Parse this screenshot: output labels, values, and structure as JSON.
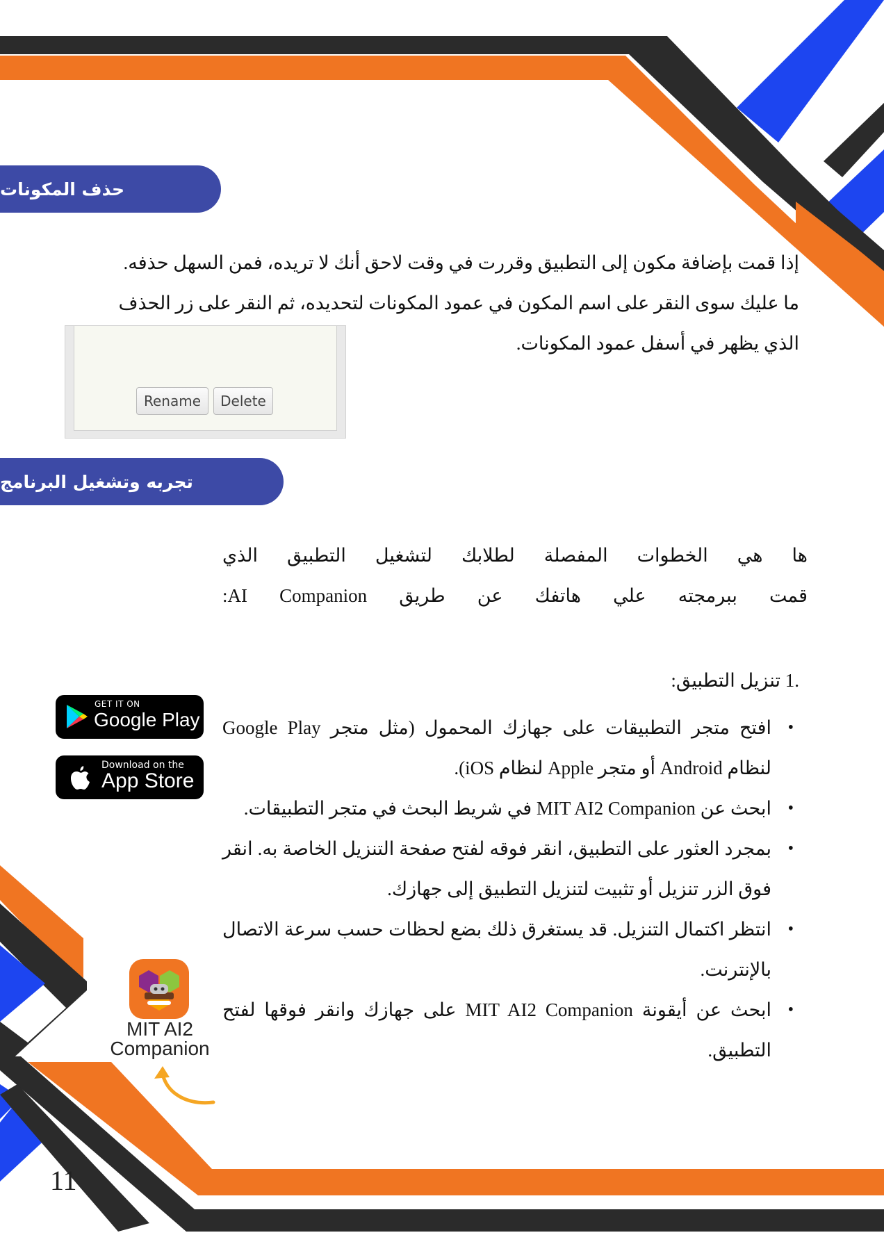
{
  "sections": {
    "delete_title": "حذف المكونات",
    "run_title": "تجربه وتشغيل البرنامج"
  },
  "delete_paragraph": {
    "line1": "إذا قمت بإضافة مكون إلى التطبيق وقررت في وقت لاحق أنك لا تريده، فمن السهل حذفه.",
    "line2": "ما عليك سوى النقر على اسم المكون في عمود المكونات لتحديده، ثم النقر على زر الحذف",
    "line3": "الذي يظهر في أسفل عمود المكونات."
  },
  "screenshot": {
    "rename_label": "Rename",
    "delete_label": "Delete"
  },
  "intro_paragraph": {
    "line1": "ها هي الخطوات المفصلة لطلابك لتشغيل التطبيق الذي",
    "line2": "قمت ببرمجته علي هاتفك عن طريق AI Companion:"
  },
  "steps": {
    "title": ".1 تنزيل التطبيق:",
    "bullets": [
      "افتح متجر التطبيقات على جهازك المحمول (مثل متجر Google Play لنظام Android أو متجر Apple لنظام iOS).",
      "ابحث عن MIT AI2 Companion في شريط البحث في متجر التطبيقات.",
      "بمجرد العثور على التطبيق، انقر فوقه لفتح صفحة التنزيل الخاصة به. انقر فوق الزر تنزيل أو تثبيت لتنزيل التطبيق إلى جهازك.",
      "انتظر اكتمال التنزيل. قد يستغرق ذلك بضع لحظات حسب سرعة الاتصال بالإنترنت.",
      "ابحث عن أيقونة MIT AI2 Companion على جهازك وانقر فوقها لفتح التطبيق."
    ]
  },
  "badges": {
    "google_small": "GET IT ON",
    "google_big": "Google Play",
    "apple_small": "Download on the",
    "apple_big": "App Store"
  },
  "ai2_label": {
    "line1": "MIT AI2",
    "line2": "Companion"
  },
  "page_number": "11",
  "colors": {
    "orange": "#f07522",
    "dark": "#2b2b2b",
    "blue": "#1d45f0",
    "pill": "#3d4aa6"
  }
}
